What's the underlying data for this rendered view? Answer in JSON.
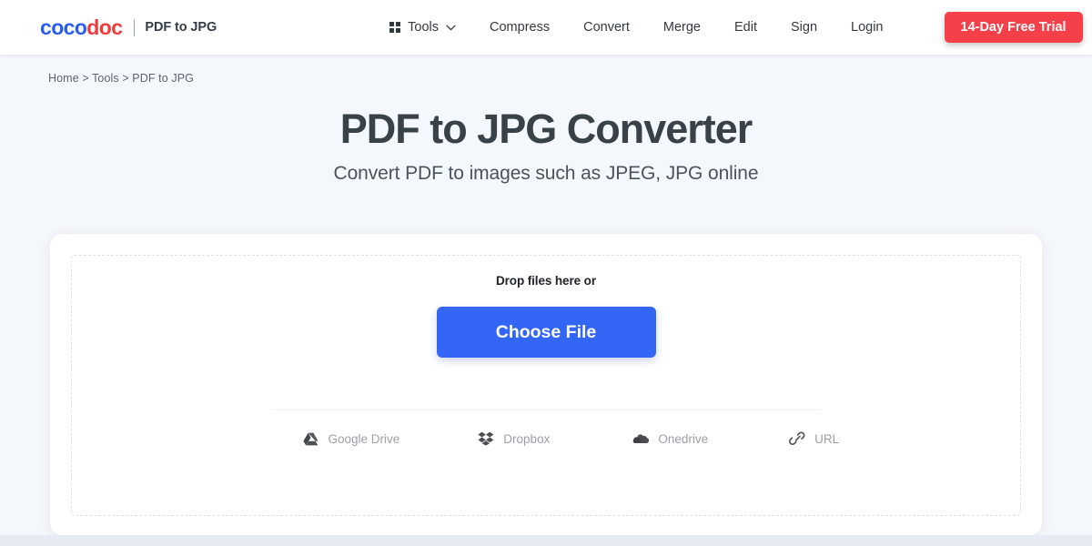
{
  "header": {
    "logo_coco": "coco",
    "logo_doc": "doc",
    "logo_subtitle": "PDF to JPG",
    "nav": [
      {
        "label": "Tools",
        "icon": "grid-icon",
        "has_chevron": true
      },
      {
        "label": "Compress",
        "icon": null,
        "has_chevron": false
      },
      {
        "label": "Convert",
        "icon": null,
        "has_chevron": false
      },
      {
        "label": "Merge",
        "icon": null,
        "has_chevron": false
      },
      {
        "label": "Edit",
        "icon": null,
        "has_chevron": false
      },
      {
        "label": "Sign",
        "icon": null,
        "has_chevron": false
      },
      {
        "label": "Login",
        "icon": null,
        "has_chevron": false
      }
    ],
    "trial_button": "14-Day Free Trial"
  },
  "hero": {
    "breadcrumb": "Home > Tools > PDF to JPG",
    "title": "PDF to JPG Converter",
    "subtitle": "Convert PDF to images such as JPEG, JPG online"
  },
  "uploader": {
    "drop_label": "Drop files here or",
    "choose_button": "Choose File",
    "sources": [
      {
        "label": "Google Drive",
        "icon": "google-drive-icon"
      },
      {
        "label": "Dropbox",
        "icon": "dropbox-icon"
      },
      {
        "label": "Onedrive",
        "icon": "onedrive-icon"
      },
      {
        "label": "URL",
        "icon": "link-icon"
      }
    ]
  },
  "colors": {
    "brand_blue": "#2a5cf0",
    "brand_red": "#ef3b3b",
    "cta_red": "#f5404a",
    "primary_blue": "#3366f5",
    "page_bg": "#f4f7fb"
  }
}
